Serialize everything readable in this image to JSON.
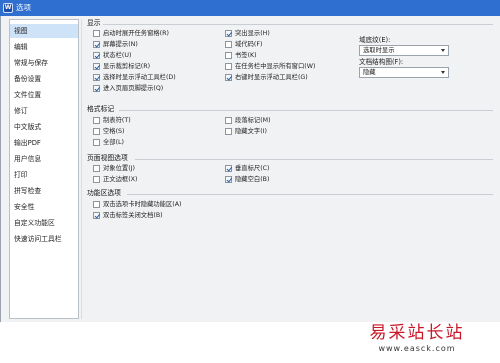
{
  "window": {
    "title": "选项",
    "icon": "W"
  },
  "sidebar": {
    "items": [
      {
        "label": "视图",
        "active": true
      },
      {
        "label": "编辑"
      },
      {
        "label": "常规与保存"
      },
      {
        "label": "备份设置"
      },
      {
        "label": "文件位置"
      },
      {
        "label": "修订"
      },
      {
        "label": "中文版式"
      },
      {
        "label": "输出PDF"
      },
      {
        "label": "用户信息"
      },
      {
        "label": "打印"
      },
      {
        "label": "拼写检查"
      },
      {
        "label": "安全性"
      },
      {
        "label": "自定义功能区"
      },
      {
        "label": "快速访问工具栏"
      }
    ]
  },
  "sections": {
    "display": {
      "title": "显示",
      "left": [
        {
          "label": "启动时展开任务窗格(R)",
          "checked": false
        },
        {
          "label": "屏幕提示(N)",
          "checked": true
        },
        {
          "label": "状态栏(U)",
          "checked": true
        },
        {
          "label": "显示裁剪标记(R)",
          "checked": true
        },
        {
          "label": "选择时显示浮动工具栏(D)",
          "checked": true
        },
        {
          "label": "进入页眉页脚提示(Q)",
          "checked": true
        }
      ],
      "mid": [
        {
          "label": "突出显示(H)",
          "checked": true
        },
        {
          "label": "域代码(F)",
          "checked": false
        },
        {
          "label": "书签(K)",
          "checked": false
        },
        {
          "label": "在任务栏中显示所有窗口(W)",
          "checked": false
        },
        {
          "label": "右键时显示浮动工具栏(G)",
          "checked": true
        }
      ],
      "shading_label": "域底纹(E):",
      "shading_value": "选取时显示",
      "docmap_label": "文档结构图(F):",
      "docmap_value": "隐藏"
    },
    "format_marks": {
      "title": "格式标记",
      "left": [
        {
          "label": "制表符(T)",
          "checked": false
        },
        {
          "label": "空格(S)",
          "checked": false
        },
        {
          "label": "全部(L)",
          "checked": false
        }
      ],
      "mid": [
        {
          "label": "段落标记(M)",
          "checked": false
        },
        {
          "label": "隐藏文字(I)",
          "checked": false
        }
      ]
    },
    "page_view": {
      "title": "页面视图选项",
      "left": [
        {
          "label": "对象位置(J)",
          "checked": false
        },
        {
          "label": "正文边框(X)",
          "checked": false
        }
      ],
      "mid": [
        {
          "label": "垂直标尺(C)",
          "checked": true
        },
        {
          "label": "隐藏空白(B)",
          "checked": true
        }
      ]
    },
    "ribbon": {
      "title": "功能区选项",
      "left": [
        {
          "label": "双击选项卡时隐藏功能区(A)",
          "checked": false
        },
        {
          "label": "双击标签关闭文档(B)",
          "checked": true
        }
      ]
    }
  },
  "watermark": {
    "text": "易采站长站",
    "url": "www.easck.com"
  }
}
